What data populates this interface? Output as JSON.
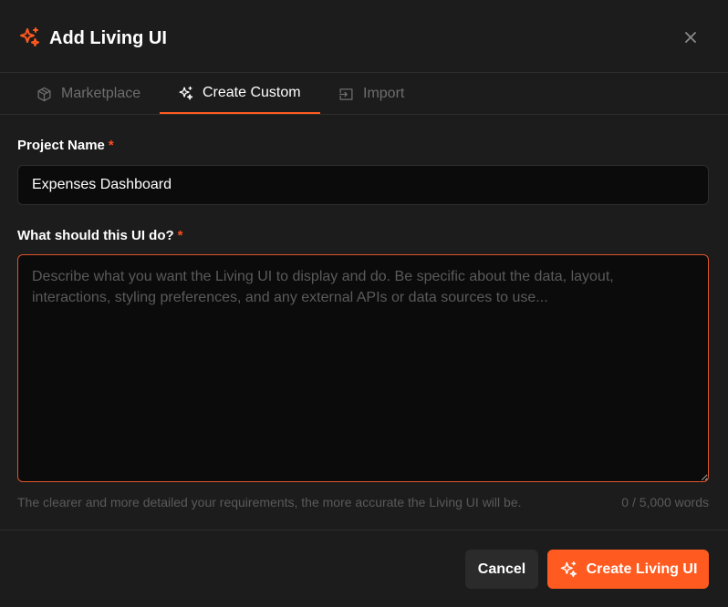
{
  "dialog": {
    "title": "Add Living UI",
    "close_icon": "close-icon",
    "accent_color": "#ff5a1f"
  },
  "tabs": [
    {
      "label": "Marketplace",
      "icon": "package-icon",
      "active": false
    },
    {
      "label": "Create Custom",
      "icon": "sparkles-icon",
      "active": true
    },
    {
      "label": "Import",
      "icon": "import-icon",
      "active": false
    }
  ],
  "form": {
    "project_name_label": "Project Name",
    "required_marker": "*",
    "project_name_value": "Expenses Dashboard",
    "description_label": "What should this UI do?",
    "description_placeholder": "Describe what you want the Living UI to display and do. Be specific about the data, layout, interactions, styling preferences, and any external APIs or data sources to use...",
    "description_value": "",
    "hint": "The clearer and more detailed your requirements, the more accurate the Living UI will be.",
    "word_count": "0 / 5,000 words"
  },
  "footer": {
    "cancel_label": "Cancel",
    "create_label": "Create Living UI"
  }
}
